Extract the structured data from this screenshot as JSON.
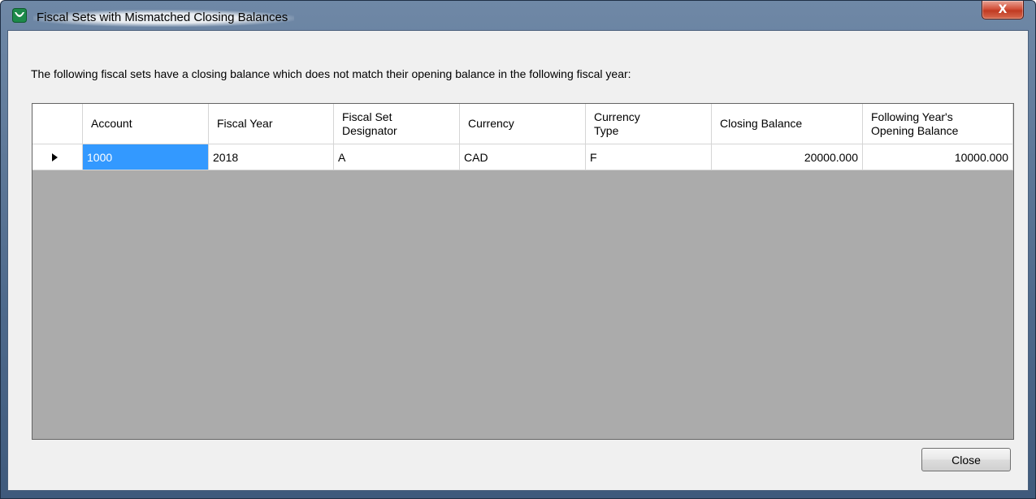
{
  "window": {
    "title": "Fiscal Sets with Mismatched Closing Balances",
    "close_glyph": "X"
  },
  "message": "The following fiscal sets have a closing balance which does not match their opening balance in the following fiscal year:",
  "grid": {
    "columns": [
      "",
      "Account",
      "Fiscal Year",
      "Fiscal Set\nDesignator",
      "Currency",
      "Currency\nType",
      "Closing Balance",
      "Following Year's\nOpening Balance"
    ],
    "rows": [
      {
        "account": "1000",
        "fiscal_year": "2018",
        "designator": "A",
        "currency": "CAD",
        "currency_type": "F",
        "closing_balance": "20000.000",
        "opening_balance": "10000.000"
      }
    ]
  },
  "buttons": {
    "close_label": "Close"
  },
  "colors": {
    "selection": "#3399ff",
    "grid_background": "#ababab",
    "dialog_background": "#f0f0f0"
  },
  "icons": {
    "app": "green-shield-check-icon",
    "row_indicator": "triangle-right-icon",
    "window_close": "close-icon"
  }
}
